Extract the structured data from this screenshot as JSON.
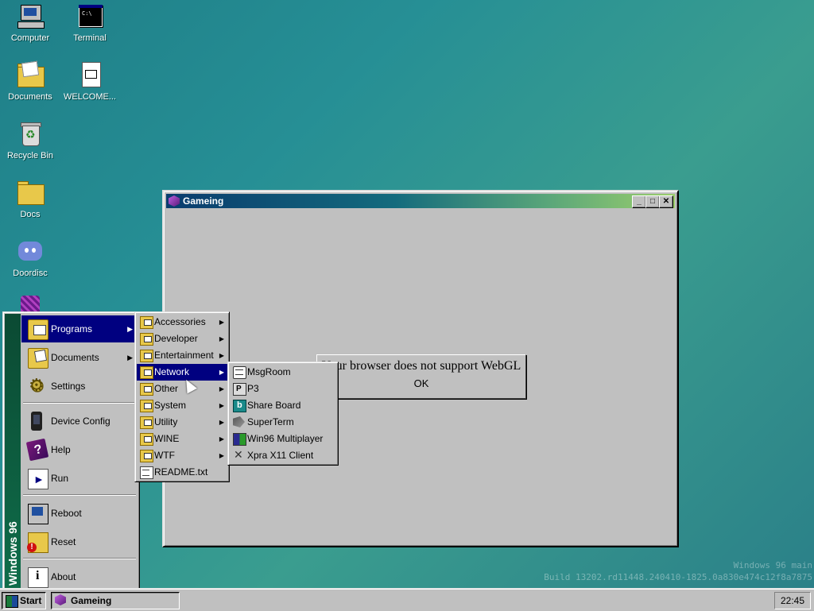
{
  "desktop": {
    "icons": [
      {
        "label": "Computer",
        "icon": "computer-icon"
      },
      {
        "label": "Terminal",
        "icon": "terminal-icon"
      },
      {
        "label": "Documents",
        "icon": "documents-folder-icon"
      },
      {
        "label": "WELCOME...",
        "icon": "markdown-file-icon"
      },
      {
        "label": "Recycle Bin",
        "icon": "recycle-bin-icon"
      },
      {
        "label": "Docs",
        "icon": "folder-icon"
      },
      {
        "label": "Doordisc",
        "icon": "discord-icon"
      }
    ]
  },
  "window": {
    "title": "Gameing",
    "buttons": {
      "minimize": "_",
      "maximize": "□",
      "close": "✕"
    },
    "dialog": {
      "message": "Your browser does not support WebGL",
      "ok_label": "OK"
    }
  },
  "start_menu": {
    "banner": "Windows 96",
    "items": [
      {
        "label": "Programs",
        "arrow": "▶"
      },
      {
        "label": "Documents",
        "arrow": "▶"
      },
      {
        "label": "Settings",
        "arrow": ""
      },
      {
        "label": "Device Config",
        "arrow": ""
      },
      {
        "label": "Help",
        "arrow": ""
      },
      {
        "label": "Run",
        "arrow": ""
      },
      {
        "label": "Reboot",
        "arrow": ""
      },
      {
        "label": "Reset",
        "arrow": ""
      },
      {
        "label": "About",
        "arrow": ""
      }
    ]
  },
  "programs_menu": {
    "items": [
      {
        "label": "Accessories",
        "arrow": "▶"
      },
      {
        "label": "Developer",
        "arrow": "▶"
      },
      {
        "label": "Entertainment",
        "arrow": "▶"
      },
      {
        "label": "Network",
        "arrow": "▶"
      },
      {
        "label": "Other",
        "arrow": "▶"
      },
      {
        "label": "System",
        "arrow": "▶"
      },
      {
        "label": "Utility",
        "arrow": "▶"
      },
      {
        "label": "WINE",
        "arrow": "▶"
      },
      {
        "label": "WTF",
        "arrow": "▶"
      },
      {
        "label": "README.txt",
        "arrow": ""
      }
    ]
  },
  "network_menu": {
    "items": [
      {
        "label": "MsgRoom"
      },
      {
        "label": "P3"
      },
      {
        "label": "Share Board"
      },
      {
        "label": "SuperTerm"
      },
      {
        "label": "Win96 Multiplayer"
      },
      {
        "label": "Xpra X11 Client"
      }
    ]
  },
  "watermark": {
    "line1": "Windows 96 main",
    "line2": "Build 13202.rd11448.240410-1825.0a830e474c12f8a7875"
  },
  "taskbar": {
    "start_label": "Start",
    "task_label": "Gameing",
    "clock": "22:45"
  }
}
